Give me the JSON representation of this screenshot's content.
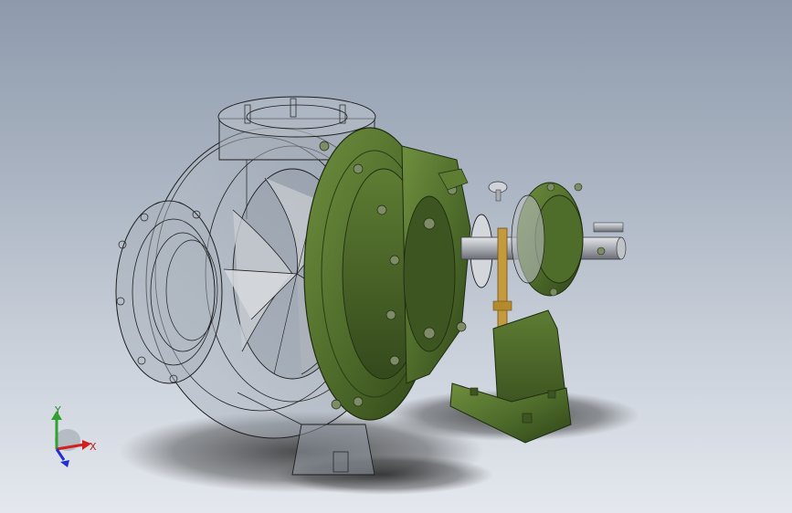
{
  "viewport": {
    "background_top": "#8e9aac",
    "background_bottom": "#e4e8ee"
  },
  "model": {
    "body_color": "#4d6a2a",
    "body_dark": "#34491c",
    "body_light": "#6f8f3e",
    "transparent_fill": "#9aa3ae",
    "wire_color": "#1e1e1e",
    "shaft_color": "#a9adb3",
    "brass_color": "#c49a3c"
  },
  "triad": {
    "x_label": "X",
    "y_label": "Y",
    "x_color": "#d02020",
    "y_color": "#30a030",
    "z_color": "#2030d0"
  }
}
